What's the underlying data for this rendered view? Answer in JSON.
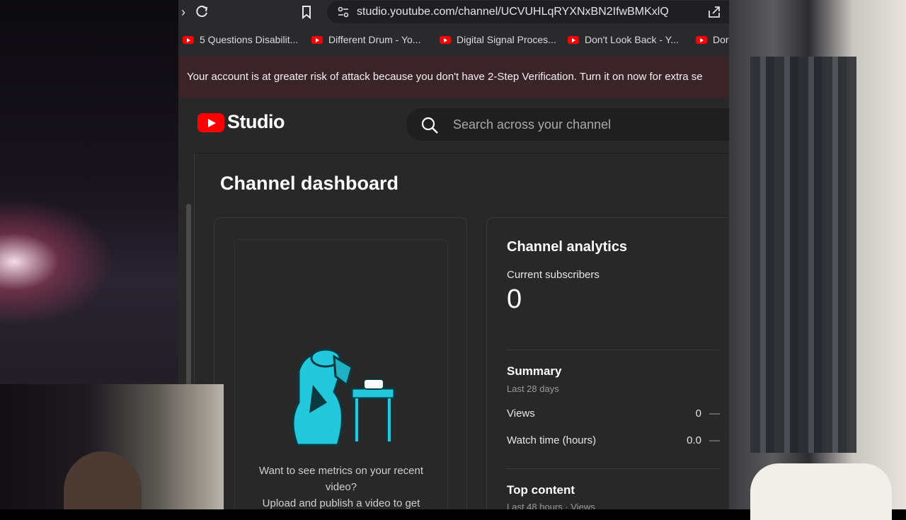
{
  "browser": {
    "url": "studio.youtube.com/channel/UCVUHLqRYXNxBN2IfwBMKxlQ"
  },
  "bookmarks": [
    {
      "label": "5 Questions Disabilit..."
    },
    {
      "label": "Different Drum - Yo..."
    },
    {
      "label": "Digital Signal Proces..."
    },
    {
      "label": "Don't Look Back - Y..."
    },
    {
      "label": "Dor"
    }
  ],
  "warning": {
    "text": "Your account is at greater risk of attack because you don't have 2-Step Verification. Turn it on now for extra se"
  },
  "studio": {
    "logo_text": "Studio",
    "search_placeholder": "Search across your channel"
  },
  "dashboard": {
    "title": "Channel dashboard",
    "upload_prompt": {
      "line1": "Want to see metrics on your recent",
      "line2": "video?",
      "line3": "Upload and publish a video to get"
    },
    "analytics": {
      "title": "Channel analytics",
      "subscribers_label": "Current subscribers",
      "subscribers_value": "0",
      "summary_title": "Summary",
      "summary_period": "Last 28 days",
      "rows": [
        {
          "label": "Views",
          "value": "0",
          "trend": "—"
        },
        {
          "label": "Watch time (hours)",
          "value": "0.0",
          "trend": "—"
        }
      ],
      "top_content_title": "Top content",
      "top_content_period": "Last 48 hours · Views"
    }
  },
  "colors": {
    "brand_red": "#ff0000",
    "warning_bg": "#3b2428",
    "page_bg": "#282828",
    "illustration_cyan": "#24c8dc"
  }
}
